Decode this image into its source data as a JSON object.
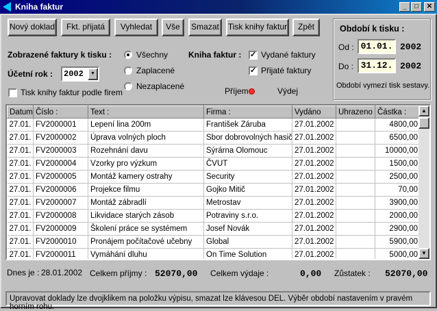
{
  "window": {
    "title": "Kniha faktur",
    "controls": {
      "minimize": "_",
      "maximize": "□",
      "close": "✕"
    }
  },
  "toolbar": {
    "buttons": [
      {
        "label": "Nový doklad"
      },
      {
        "label": "Fkt. přijatá"
      },
      {
        "label": "Vyhledat"
      },
      {
        "label": "Vše"
      },
      {
        "label": "Smazat"
      },
      {
        "label": "Tisk knihy faktur"
      },
      {
        "label": "Zpět"
      }
    ]
  },
  "period": {
    "title": "Období k tisku :",
    "from_label": "Od :",
    "from_value": "01.01.",
    "from_year": "2002",
    "to_label": "Do :",
    "to_value": "31.12.",
    "to_year": "2002",
    "note": "Období vymezí tisk sestavy."
  },
  "filters": {
    "shown_label": "Zobrazené faktury k tisku :",
    "year_label": "Účetní rok :",
    "year_value": "2002",
    "print_by_firms": "Tisk knihy faktur podle firem",
    "radios": [
      {
        "label": "Všechny",
        "checked": true
      },
      {
        "label": "Zaplacené",
        "checked": false
      },
      {
        "label": "Nezaplacené",
        "checked": false
      }
    ],
    "book_label": "Kniha faktur :",
    "checks": [
      {
        "label": "Vydané faktury",
        "checked": true
      },
      {
        "label": "Přijaté faktury",
        "checked": true
      }
    ],
    "income_label": "Příjem",
    "expense_label": "Výdej",
    "indicator_color": "#ff3030"
  },
  "table": {
    "headers": [
      "Datum",
      "Číslo :",
      "Text :",
      "Firma :",
      "Vydáno",
      "Uhrazeno",
      "Částka :"
    ],
    "rows": [
      [
        "27.01.",
        "FV2000001",
        "Lepení lina 200m",
        "František Záruba",
        "27.01.2002",
        "",
        "4800,00"
      ],
      [
        "27.01.",
        "FV2000002",
        "Úprava volných ploch",
        "Sbor dobrovolných hasičů",
        "27.01.2002",
        "",
        "6500,00"
      ],
      [
        "27.01.",
        "FV2000003",
        "Rozehnání davu",
        "Sýrárna Olomouc",
        "27.01.2002",
        "",
        "10000,00"
      ],
      [
        "27.01.",
        "FV2000004",
        "Vzorky pro výzkum",
        "ČVUT",
        "27.01.2002",
        "",
        "1500,00"
      ],
      [
        "27.01.",
        "FV2000005",
        "Montáž kamery ostrahy",
        "Security",
        "27.01.2002",
        "",
        "2500,00"
      ],
      [
        "27.01.",
        "FV2000006",
        "Projekce filmu",
        "Gojko Mitič",
        "27.01.2002",
        "",
        "70,00"
      ],
      [
        "27.01.",
        "FV2000007",
        "Montáž zábradlí",
        "Metrostav",
        "27.01.2002",
        "",
        "3900,00"
      ],
      [
        "27.01.",
        "FV2000008",
        "Likvidace starých zásob",
        "Potraviny s.r.o.",
        "27.01.2002",
        "",
        "2000,00"
      ],
      [
        "27.01.",
        "FV2000009",
        "Školení práce se systémem",
        "Josef Novák",
        "27.01.2002",
        "",
        "2900,00"
      ],
      [
        "27.01.",
        "FV2000010",
        "Pronájem počítačové učebny",
        "Global",
        "27.01.2002",
        "",
        "5900,00"
      ],
      [
        "27.01.",
        "FV2000011",
        "Vymáhání dluhu",
        "On Time Solution",
        "27.01.2002",
        "",
        "5000,00"
      ]
    ]
  },
  "summary": {
    "today_label": "Dnes je :",
    "today_value": "28.01.2002",
    "income_label": "Celkem příjmy :",
    "income_value": "52070,00",
    "expense_label": "Celkem výdaje :",
    "expense_value": "0,00",
    "balance_label": "Zůstatek :",
    "balance_value": "52070,00"
  },
  "status_text": "Upravovat doklady lze dvojklikem na položku výpisu, smazat lze klávesou DEL. Výběr období nastavením v pravém horním rohu."
}
